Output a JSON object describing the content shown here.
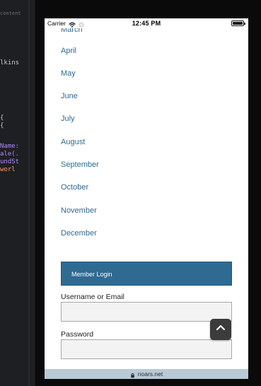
{
  "editor": {
    "tab_fragment": "content",
    "code_fragments": {
      "l1": "lkins",
      "l2": "{",
      "l3": "{",
      "l4": "Name:",
      "l5": "ale(.",
      "l6": "undSt",
      "l7": " worl"
    }
  },
  "status_bar": {
    "carrier": "Carrier",
    "wifi_icon": "wifi-icon",
    "spinner_icon": "activity-spinner-icon",
    "time": "12:45 PM",
    "battery_icon": "battery-icon"
  },
  "content": {
    "partial_month": "March",
    "months": [
      "April",
      "May",
      "June",
      "July",
      "August",
      "September",
      "October",
      "November",
      "December"
    ],
    "member_login": {
      "title": "Member Login"
    },
    "login_form": {
      "username_label": "Username or Email",
      "username_value": "",
      "username_placeholder": "",
      "password_label": "Password",
      "password_value": "",
      "password_placeholder": ""
    },
    "scroll_to_top_icon": "chevron-up-icon"
  },
  "url_bar": {
    "lock_icon": "lock-icon",
    "domain": "noars.net"
  },
  "colors": {
    "link": "#2f6a93",
    "member_login_bg": "#2f6a93",
    "scroll_button_bg": "#3b3b3b",
    "url_bar_bg": "#b9cad6",
    "input_bg": "#f3f3f3"
  }
}
